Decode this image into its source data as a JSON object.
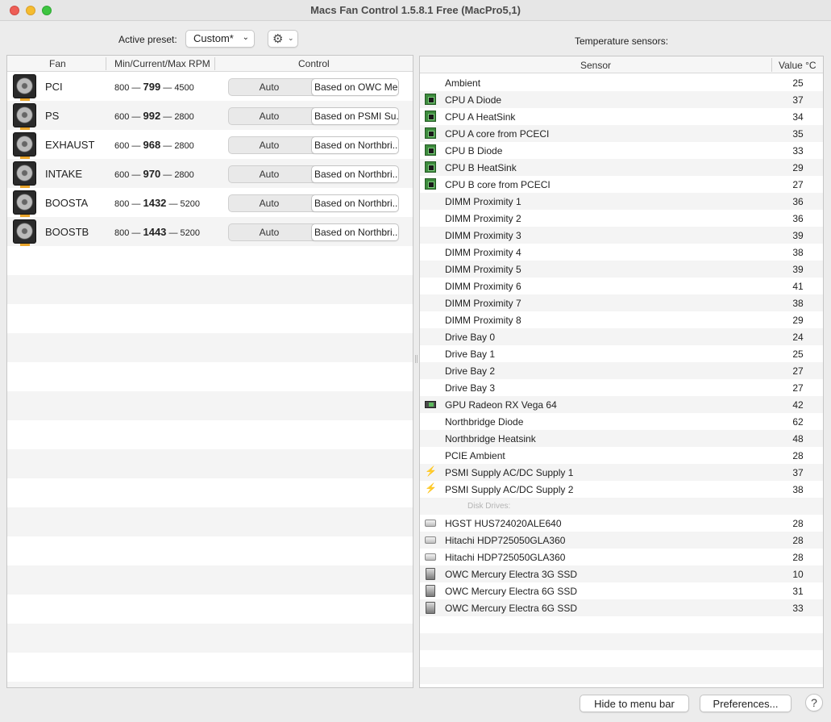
{
  "window": {
    "title": "Macs Fan Control 1.5.8.1 Free (MacPro5,1)"
  },
  "toolbar": {
    "active_preset_label": "Active preset:",
    "preset_value": "Custom*",
    "temperature_label": "Temperature sensors:"
  },
  "fan_table": {
    "headers": {
      "fan": "Fan",
      "rpm": "Min/Current/Max RPM",
      "control": "Control"
    },
    "rows": [
      {
        "name": "PCI",
        "min": "800",
        "current": "799",
        "max": "4500",
        "mode": "Auto",
        "based": "Based on OWC Me..."
      },
      {
        "name": "PS",
        "min": "600",
        "current": "992",
        "max": "2800",
        "mode": "Auto",
        "based": "Based on PSMI Su..."
      },
      {
        "name": "EXHAUST",
        "min": "600",
        "current": "968",
        "max": "2800",
        "mode": "Auto",
        "based": "Based on Northbri..."
      },
      {
        "name": "INTAKE",
        "min": "600",
        "current": "970",
        "max": "2800",
        "mode": "Auto",
        "based": "Based on Northbri..."
      },
      {
        "name": "BOOSTA",
        "min": "800",
        "current": "1432",
        "max": "5200",
        "mode": "Auto",
        "based": "Based on Northbri..."
      },
      {
        "name": "BOOSTB",
        "min": "800",
        "current": "1443",
        "max": "5200",
        "mode": "Auto",
        "based": "Based on Northbri..."
      }
    ]
  },
  "sensor_table": {
    "headers": {
      "sensor": "Sensor",
      "value": "Value °C"
    },
    "rows": [
      {
        "icon": "",
        "name": "Ambient",
        "value": "25"
      },
      {
        "icon": "cpu-chip-icon",
        "name": "CPU A Diode",
        "value": "37"
      },
      {
        "icon": "cpu-chip-icon",
        "name": "CPU A HeatSink",
        "value": "34"
      },
      {
        "icon": "cpu-chip-icon",
        "name": "CPU A core from PCECI",
        "value": "35"
      },
      {
        "icon": "cpu-chip-icon",
        "name": "CPU B Diode",
        "value": "33"
      },
      {
        "icon": "cpu-chip-icon",
        "name": "CPU B HeatSink",
        "value": "29"
      },
      {
        "icon": "cpu-chip-icon",
        "name": "CPU B core from PCECI",
        "value": "27"
      },
      {
        "icon": "",
        "name": "DIMM Proximity 1",
        "value": "36"
      },
      {
        "icon": "",
        "name": "DIMM Proximity 2",
        "value": "36"
      },
      {
        "icon": "",
        "name": "DIMM Proximity 3",
        "value": "39"
      },
      {
        "icon": "",
        "name": "DIMM Proximity 4",
        "value": "38"
      },
      {
        "icon": "",
        "name": "DIMM Proximity 5",
        "value": "39"
      },
      {
        "icon": "",
        "name": "DIMM Proximity 6",
        "value": "41"
      },
      {
        "icon": "",
        "name": "DIMM Proximity 7",
        "value": "38"
      },
      {
        "icon": "",
        "name": "DIMM Proximity 8",
        "value": "29"
      },
      {
        "icon": "",
        "name": "Drive Bay 0",
        "value": "24"
      },
      {
        "icon": "",
        "name": "Drive Bay 1",
        "value": "25"
      },
      {
        "icon": "",
        "name": "Drive Bay 2",
        "value": "27"
      },
      {
        "icon": "",
        "name": "Drive Bay 3",
        "value": "27"
      },
      {
        "icon": "gpu-card-icon",
        "name": "GPU Radeon RX Vega 64",
        "value": "42"
      },
      {
        "icon": "",
        "name": "Northbridge Diode",
        "value": "62"
      },
      {
        "icon": "",
        "name": "Northbridge Heatsink",
        "value": "48"
      },
      {
        "icon": "",
        "name": "PCIE Ambient",
        "value": "28"
      },
      {
        "icon": "lightning-bolt-icon",
        "name": "PSMI Supply AC/DC Supply 1",
        "value": "37"
      },
      {
        "icon": "lightning-bolt-icon",
        "name": "PSMI Supply AC/DC Supply 2",
        "value": "38"
      },
      {
        "section": "Disk Drives:"
      },
      {
        "icon": "hard-drive-icon",
        "name": "HGST HUS724020ALE640",
        "value": "28"
      },
      {
        "icon": "hard-drive-icon",
        "name": "Hitachi HDP725050GLA360",
        "value": "28"
      },
      {
        "icon": "hard-drive-icon",
        "name": "Hitachi HDP725050GLA360",
        "value": "28"
      },
      {
        "icon": "ssd-icon",
        "name": "OWC Mercury Electra 3G SSD",
        "value": "10"
      },
      {
        "icon": "ssd-icon",
        "name": "OWC Mercury Electra 6G SSD",
        "value": "31"
      },
      {
        "icon": "ssd-icon",
        "name": "OWC Mercury Electra 6G SSD",
        "value": "33"
      }
    ]
  },
  "buttons": {
    "hide": "Hide to menu bar",
    "preferences": "Preferences...",
    "help": "?"
  }
}
